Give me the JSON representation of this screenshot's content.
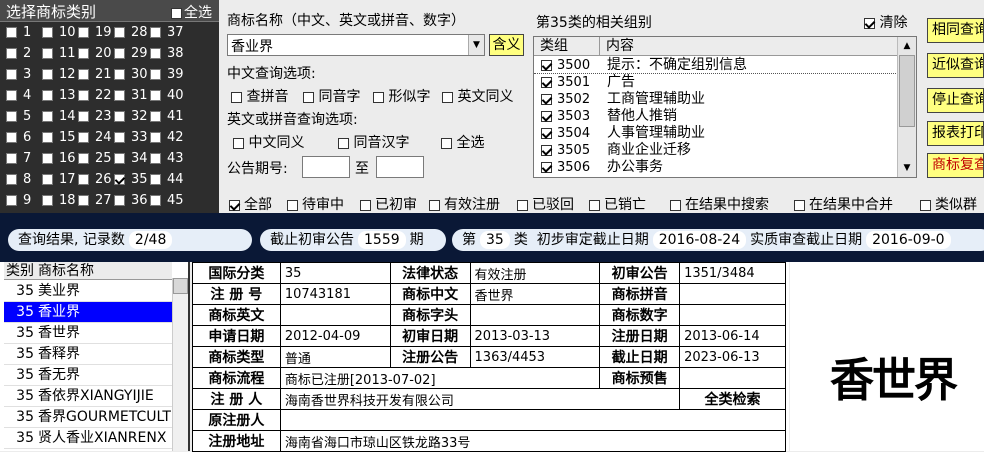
{
  "class_panel": {
    "title": "选择商标类别",
    "select_all": "全选",
    "checked_class": "35",
    "columns": [
      [
        "1",
        "2",
        "3",
        "4",
        "5",
        "6",
        "7",
        "8",
        "9"
      ],
      [
        "10",
        "11",
        "12",
        "13",
        "14",
        "15",
        "16",
        "17",
        "18"
      ],
      [
        "19",
        "20",
        "21",
        "22",
        "23",
        "24",
        "25",
        "26",
        "27"
      ],
      [
        "28",
        "29",
        "30",
        "31",
        "32",
        "33",
        "34",
        "35",
        "36"
      ],
      [
        "37",
        "38",
        "39",
        "40",
        "41",
        "42",
        "43",
        "44",
        "45"
      ]
    ]
  },
  "search": {
    "name_label": "商标名称（中文、英文或拼音、数字）",
    "name_value": "香业界",
    "contains_btn": "含义",
    "cn_options_label": "中文查询选项:",
    "cn_options": [
      "查拼音",
      "同音字",
      "形似字",
      "英文同义"
    ],
    "en_options_label": "英文或拼音查询选项:",
    "en_options": [
      "中文同义",
      "同音汉字",
      "全选"
    ],
    "period_label": "公告期号:",
    "period_to": "至"
  },
  "groups": {
    "title": "第35类的相关组别",
    "clear_label": "清除",
    "col_class": "类组",
    "col_content": "内容",
    "rows": [
      {
        "code": "3500",
        "name": "提示：不确定组别信息"
      },
      {
        "code": "3501",
        "name": "广告"
      },
      {
        "code": "3502",
        "name": "工商管理辅助业"
      },
      {
        "code": "3503",
        "name": "替他人推销"
      },
      {
        "code": "3504",
        "name": "人事管理辅助业"
      },
      {
        "code": "3505",
        "name": "商业企业迁移"
      },
      {
        "code": "3506",
        "name": "办公事务"
      }
    ]
  },
  "side_buttons": [
    "相同查询",
    "近似查询",
    "停止查询",
    "报表打印",
    "商标复查"
  ],
  "filters": [
    "全部",
    "待审中",
    "已初审",
    "有效注册",
    "已驳回",
    "已销亡",
    "在结果中搜索",
    "在结果中合并",
    "类似群"
  ],
  "status": {
    "result_label": "查询结果, 记录数",
    "result_count": "2/48",
    "cutoff_label": "截止初审公告",
    "cutoff_value": "1559",
    "cutoff_unit": "期",
    "class_prefix": "第",
    "class_value": "35",
    "class_suffix": "类",
    "prelim_label": "初步审定截止日期",
    "prelim_date": "2016-08-24",
    "actual_label": "实质审查截止日期",
    "actual_date": "2016-09-0"
  },
  "results": {
    "col_class": "类别",
    "col_name": "商标名称",
    "rows": [
      {
        "cls": "35",
        "name": "美业界"
      },
      {
        "cls": "35",
        "name": "香业界"
      },
      {
        "cls": "35",
        "name": "香世界"
      },
      {
        "cls": "35",
        "name": "香释界"
      },
      {
        "cls": "35",
        "name": "香无界"
      },
      {
        "cls": "35",
        "name": "香依界XIANGYIJIE"
      },
      {
        "cls": "35",
        "name": "香界GOURMETCULTU"
      },
      {
        "cls": "35",
        "name": "贤人香业XIANRENX"
      }
    ],
    "selected_index": 1
  },
  "detail": {
    "intl_class_k": "国际分类",
    "intl_class_v": "35",
    "legal_status_k": "法律状态",
    "legal_status_v": "有效注册",
    "prelim_pub_k": "初审公告",
    "prelim_pub_v": "1351/3484",
    "reg_no_k": "注 册 号",
    "reg_no_v": "10743181",
    "cn_name_k": "商标中文",
    "cn_name_v": "香世界",
    "pinyin_k": "商标拼音",
    "pinyin_v": "",
    "en_name_k": "商标英文",
    "en_name_v": "",
    "letters_k": "商标字头",
    "letters_v": "",
    "digits_k": "商标数字",
    "digits_v": "",
    "apply_date_k": "申请日期",
    "apply_date_v": "2012-04-09",
    "prelim_date_k": "初审日期",
    "prelim_date_v": "2013-03-13",
    "reg_date_k": "注册日期",
    "reg_date_v": "2013-06-14",
    "type_k": "商标类型",
    "type_v": "普通",
    "reg_pub_k": "注册公告",
    "reg_pub_v": "1363/4453",
    "expiry_k": "截止日期",
    "expiry_v": "2023-06-13",
    "flow_k": "商标流程",
    "flow_v": "商标已注册[2013-07-02]",
    "forecast_k": "商标预售",
    "forecast_v": "",
    "registrant_k": "注 册 人",
    "registrant_v": "海南香世界科技开发有限公司",
    "all_search": "全类检索",
    "orig_registrant_k": "原注册人",
    "orig_registrant_v": "",
    "address_k": "注册地址",
    "address_v": "海南省海口市琼山区铁龙路33号"
  },
  "logo_text": "香世界"
}
